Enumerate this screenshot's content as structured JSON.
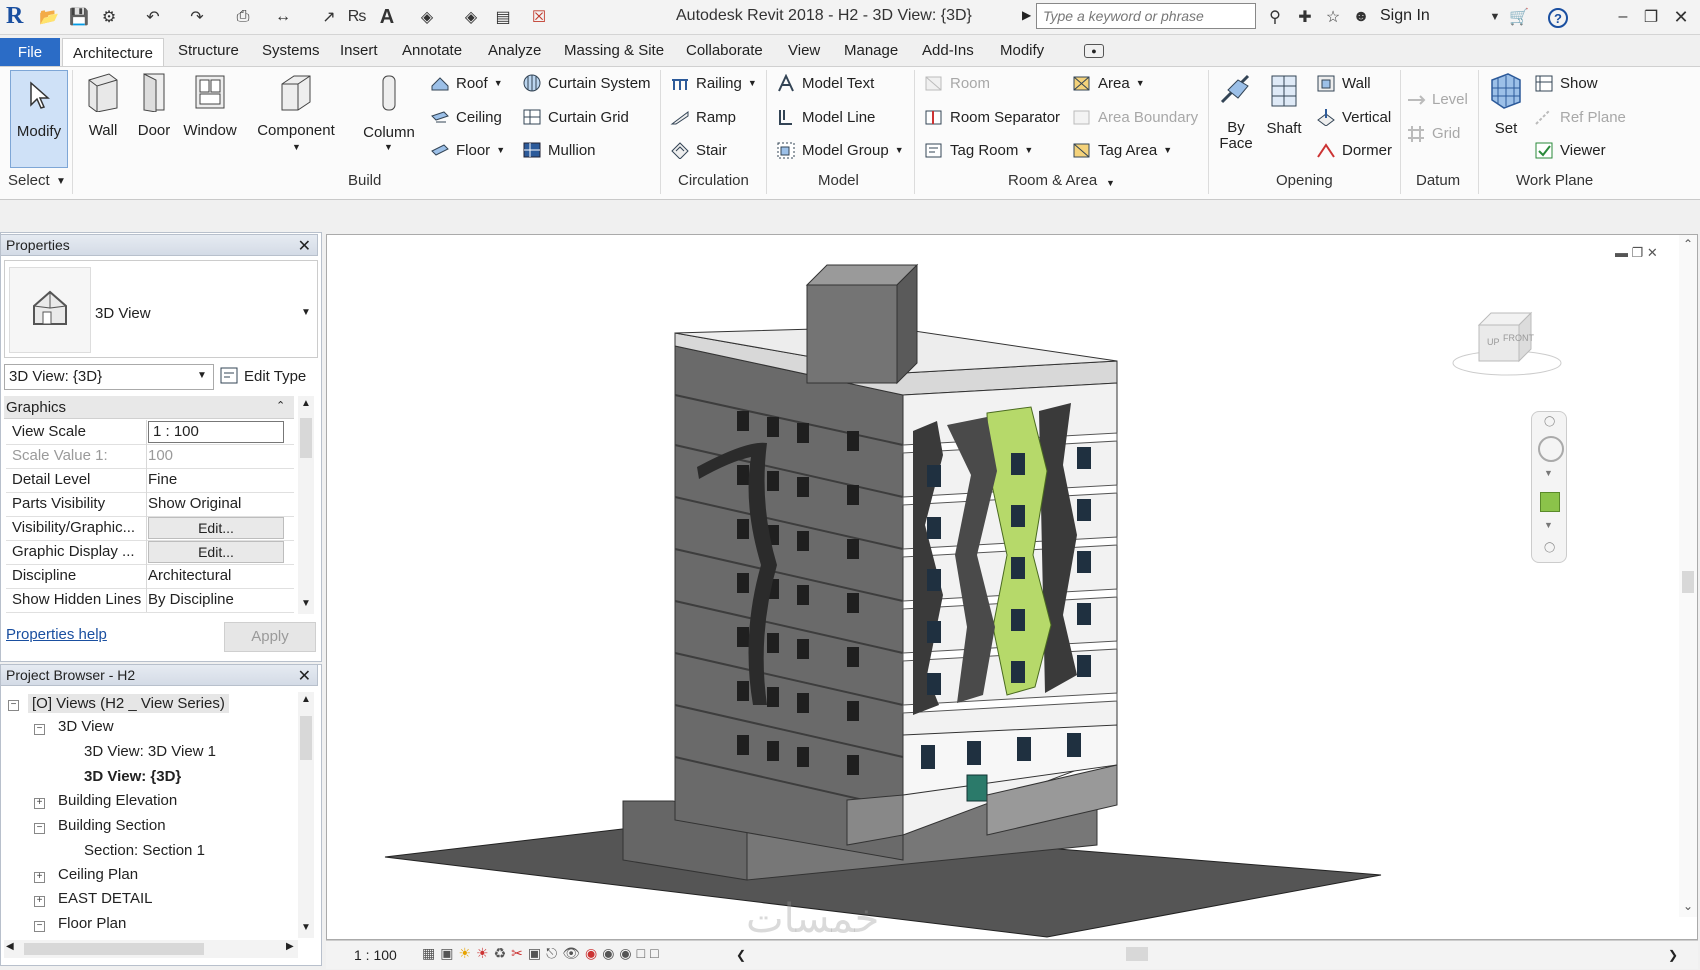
{
  "app": {
    "title": "Autodesk Revit 2018 -    H2 - 3D View: {3D}",
    "search_placeholder": "Type a keyword or phrase",
    "sign_in": "Sign In"
  },
  "tabs": [
    "File",
    "Architecture",
    "Structure",
    "Systems",
    "Insert",
    "Annotate",
    "Analyze",
    "Massing & Site",
    "Collaborate",
    "View",
    "Manage",
    "Add-Ins",
    "Modify"
  ],
  "ribbon": {
    "select": {
      "modify": "Modify",
      "label": "Select"
    },
    "build": {
      "wall": "Wall",
      "door": "Door",
      "window": "Window",
      "component": "Component",
      "column": "Column",
      "roof": "Roof",
      "ceiling": "Ceiling",
      "floor": "Floor",
      "curtain_system": "Curtain System",
      "curtain_grid": "Curtain Grid",
      "mullion": "Mullion",
      "label": "Build"
    },
    "circulation": {
      "railing": "Railing",
      "ramp": "Ramp",
      "stair": "Stair",
      "label": "Circulation"
    },
    "model": {
      "model_text": "Model Text",
      "model_line": "Model Line",
      "model_group": "Model Group",
      "label": "Model"
    },
    "room_area": {
      "room": "Room",
      "room_separator": "Room Separator",
      "tag_room": "Tag Room",
      "area": "Area",
      "area_boundary": "Area Boundary",
      "tag_area": "Tag Area",
      "label": "Room & Area"
    },
    "opening": {
      "by_face": "By Face",
      "shaft": "Shaft",
      "wall": "Wall",
      "vertical": "Vertical",
      "dormer": "Dormer",
      "label": "Opening"
    },
    "datum": {
      "level": "Level",
      "grid": "Grid",
      "label": "Datum"
    },
    "work_plane": {
      "set": "Set",
      "show": "Show",
      "ref_plane": "Ref Plane",
      "viewer": "Viewer",
      "label": "Work Plane"
    }
  },
  "properties": {
    "title": "Properties",
    "type_name": "3D View",
    "view_selector": "3D View: {3D}",
    "edit_type": "Edit Type",
    "section": "Graphics",
    "rows": [
      {
        "k": "View Scale",
        "v": "1 : 100"
      },
      {
        "k": "Scale Value    1:",
        "v": "100"
      },
      {
        "k": "Detail Level",
        "v": "Fine"
      },
      {
        "k": "Parts Visibility",
        "v": "Show Original"
      },
      {
        "k": "Visibility/Graphic...",
        "v": "Edit..."
      },
      {
        "k": "Graphic Display ...",
        "v": "Edit..."
      },
      {
        "k": "Discipline",
        "v": "Architectural"
      },
      {
        "k": "Show Hidden Lines",
        "v": "By Discipline"
      }
    ],
    "help": "Properties help",
    "apply": "Apply"
  },
  "project_browser": {
    "title": "Project Browser - H2",
    "items": [
      "Views (H2 _ View Series)",
      "3D View",
      "3D View: 3D View 1",
      "3D View: {3D}",
      "Building Elevation",
      "Building Section",
      "Section: Section 1",
      "Ceiling Plan",
      "EAST DETAIL",
      "Floor Plan"
    ]
  },
  "viewcube": {
    "left": "UP",
    "front": "FRONT"
  },
  "status": {
    "scale": "1 : 100"
  },
  "watermark": "خمسات"
}
